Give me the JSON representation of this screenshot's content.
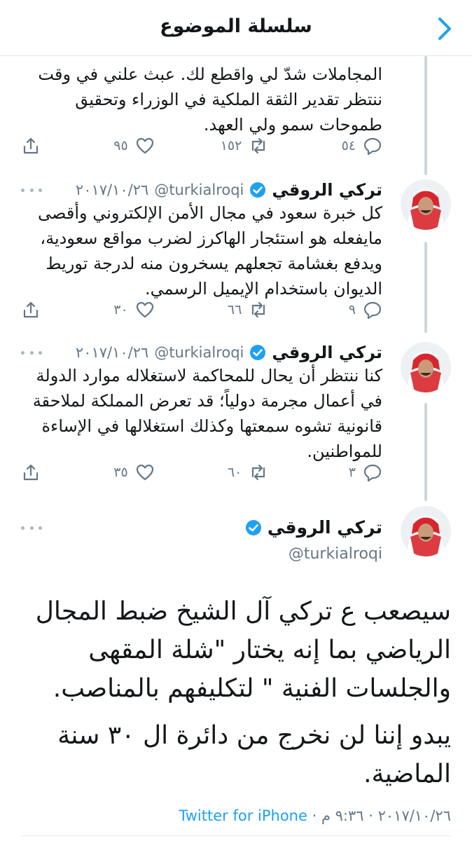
{
  "header": {
    "title": "سلسلة الموضوع"
  },
  "tweets": [
    {
      "body": "المجاملات شدّ لي واقطع لك. عبث علني في وقت ننتظر تقدير الثقة الملكية في الوزراء وتحقيق طموحات سمو ولي العهد.",
      "replies": "٥٤",
      "retweets": "١٥٢",
      "likes": "٩٥"
    },
    {
      "name": "تركي الروقي",
      "handle": "@turkialroqi",
      "date": "٢٠١٧/١٠/٢٦",
      "body": "كل خبرة سعود في مجال الأمن الإلكتروني وأقصى مايفعله هو استئجار الهاكرز لضرب مواقع سعودية، ويدفع بغشامة تجعلهم يسخرون منه لدرجة توريط الديوان باستخدام الإيميل الرسمي.",
      "replies": "٩",
      "retweets": "٦٦",
      "likes": "٣٠"
    },
    {
      "name": "تركي الروقي",
      "handle": "@turkialroqi",
      "date": "٢٠١٧/١٠/٢٦",
      "body": "كنا ننتظر أن يحال للمحاكمة لاستغلاله موارد الدولة في أعمال مجرمة دولياً؛ قد تعرض المملكة لملاحقة قانونية تشوه سمعتها وكذلك استغلالها في الإساءة للمواطنين.",
      "replies": "٣",
      "retweets": "٦٠",
      "likes": "٣٥"
    }
  ],
  "main_tweet": {
    "name": "تركي الروقي",
    "handle": "@turkialroqi",
    "paragraphs": [
      "سيصعب ع تركي آل الشيخ ضبط المجال الرياضي بما إنه يختار \"شلة المقهى والجلسات الفنية \" لتكليفهم بالمناصب.",
      "يبدو إننا لن نخرج من دائرة ال ٣٠ سنة الماضية."
    ],
    "date": "٢٠١٧/١٠/٢٦",
    "time": "٩:٣٦ م",
    "source": "Twitter for iPhone"
  },
  "icons": {
    "back": "chevron-right-icon",
    "verified": "verified-badge-icon",
    "reply": "reply-icon",
    "retweet": "retweet-icon",
    "like": "heart-icon",
    "share": "share-icon",
    "more": "more-dots-icon"
  },
  "colors": {
    "accent": "#1da1f2",
    "secondary_text": "#657786",
    "text": "#14171a",
    "thread_line": "#ccd6dd"
  }
}
